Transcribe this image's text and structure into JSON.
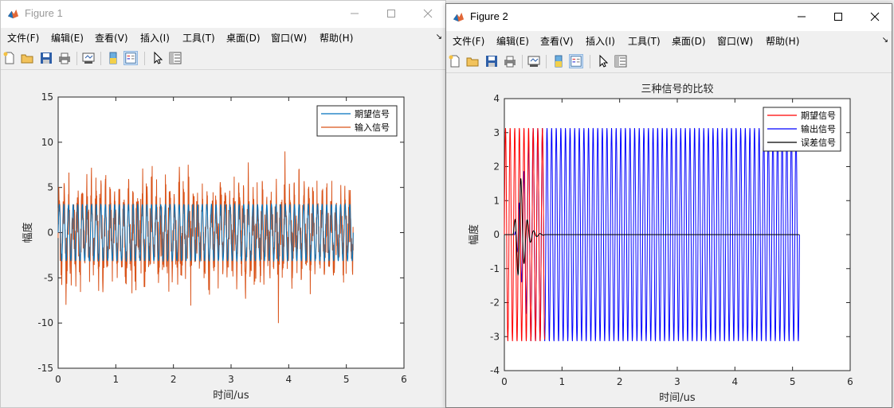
{
  "windows": [
    {
      "title": "Figure 1",
      "menu": [
        "文件(F)",
        "编辑(E)",
        "查看(V)",
        "插入(I)",
        "工具(T)",
        "桌面(D)",
        "窗口(W)",
        "帮助(H)"
      ],
      "chart_data": {
        "type": "line",
        "title": "",
        "xlabel": "时间/us",
        "ylabel": "幅度",
        "xlim": [
          0,
          6
        ],
        "ylim": [
          -15,
          15
        ],
        "xticks": [
          "0",
          "1",
          "2",
          "3",
          "4",
          "5",
          "6"
        ],
        "yticks": [
          "15",
          "10",
          "5",
          "0",
          "-5",
          "-10",
          "-15"
        ],
        "legend_position": "top-right",
        "series": [
          {
            "name": "期望信号",
            "color": "#0072bd",
            "x_end": 5.12,
            "amplitude": 3.14,
            "cycles": 64,
            "shape": "sine"
          },
          {
            "name": "输入信号",
            "color": "#d95319",
            "x_end": 5.12,
            "amplitude": 3.14,
            "cycles": 64,
            "noise_std": 3.5,
            "range": [
              -10,
              11
            ],
            "shape": "sine plus noise"
          }
        ]
      }
    },
    {
      "title": "Figure 2",
      "menu": [
        "文件(F)",
        "编辑(E)",
        "查看(V)",
        "插入(I)",
        "工具(T)",
        "桌面(D)",
        "窗口(W)",
        "帮助(H)"
      ],
      "chart_data": {
        "type": "line",
        "title": "三种信号的比较",
        "xlabel": "时间/us",
        "ylabel": "幅度",
        "xlim": [
          0,
          6
        ],
        "ylim": [
          -4,
          4
        ],
        "xticks": [
          "0",
          "1",
          "2",
          "3",
          "4",
          "5",
          "6"
        ],
        "yticks": [
          "4",
          "3",
          "2",
          "1",
          "0",
          "-1",
          "-2",
          "-3",
          "-4"
        ],
        "legend_position": "top-right",
        "series": [
          {
            "name": "期望信号",
            "color": "#ff0000",
            "x_end": 5.12,
            "amplitude": 3.14,
            "cycles": 64,
            "shape": "sine"
          },
          {
            "name": "输出信号",
            "color": "#0000ff",
            "x_end": 5.12,
            "amplitude": 3.14,
            "cycles": 64,
            "converges_at": 0.45,
            "shape": "sine"
          },
          {
            "name": "误差信号",
            "color": "#000000",
            "x_end": 5.12,
            "peak": 1.8,
            "decay": "damped to 0 by 0.6",
            "shape": "damped oscillation"
          }
        ]
      }
    }
  ]
}
